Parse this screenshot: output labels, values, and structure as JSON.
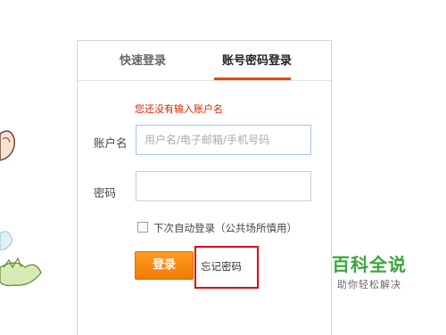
{
  "tabs": {
    "quick_login": "快速登录",
    "account_login": "账号密码登录",
    "active": "account_login"
  },
  "form": {
    "error_message": "您还没有输入账户名",
    "username_label": "账户名",
    "username_placeholder": "用户名/电子邮箱/手机号码",
    "username_value": "",
    "password_label": "密码",
    "password_value": "",
    "remember_label": "下次自动登录（公共场所慎用）",
    "remember_checked": false,
    "login_button": "登录",
    "forgot_password": "忘记密码"
  },
  "watermark": {
    "title": "百科全说",
    "subtitle": "助你轻松解决"
  },
  "colors": {
    "accent": "#e04a00",
    "button": "#f27a05",
    "error": "#e02000",
    "highlight_box": "#e00000",
    "watermark": "#3aa53f"
  }
}
